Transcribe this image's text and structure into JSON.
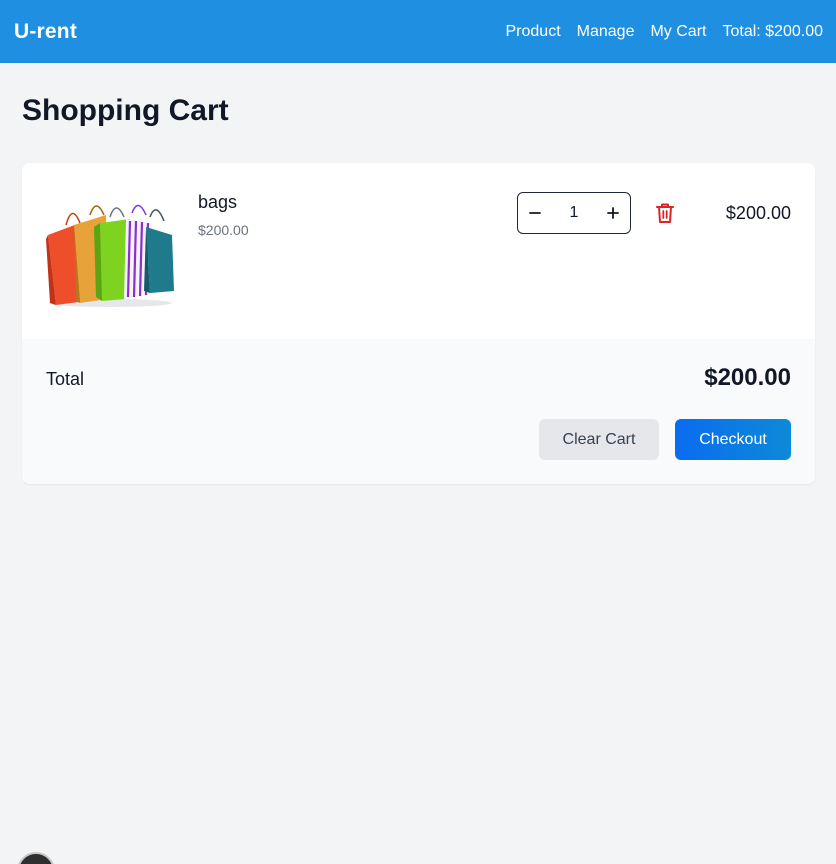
{
  "nav": {
    "brand": "U-rent",
    "links": [
      "Product",
      "Manage",
      "My Cart"
    ],
    "total": "Total: $200.00"
  },
  "page": {
    "title": "Shopping Cart"
  },
  "cart": {
    "items": [
      {
        "name": "bags",
        "unit_price": "$200.00",
        "quantity": "1",
        "line_total": "$200.00",
        "image_icon": "shopping-bags-image"
      }
    ],
    "total_label": "Total",
    "total_value": "$200.00",
    "clear_label": "Clear Cart",
    "checkout_label": "Checkout"
  },
  "colors": {
    "navbar": "#1e8fe1",
    "checkout": "#0a6cf0",
    "delete": "#dc2626"
  }
}
